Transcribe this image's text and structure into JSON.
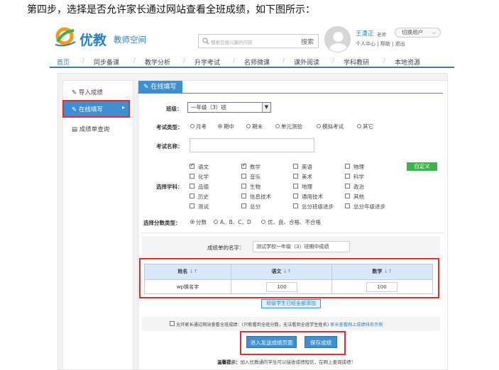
{
  "instruction": "第四步，选择是否允许家长通过网站查看全班成绩，如下图所示：",
  "header": {
    "brand": "优教",
    "brand_sub": "教师空间",
    "search_placeholder": "搜索您感兴趣的内容",
    "search_button": "搜索",
    "user_name": "王潇正",
    "user_role": "老师",
    "user_links": "个人中心 | 帮助 | 退出",
    "switch_user": "切换用户"
  },
  "nav": [
    "首页",
    "同步备课",
    "教学分析",
    "升学考试",
    "名师微课",
    "课外阅读",
    "学科教研",
    "本地资源"
  ],
  "sidebar": {
    "items": [
      "导入成绩",
      "在线填写",
      "成绩单查询"
    ]
  },
  "form": {
    "tab": "在线填写",
    "class_label": "班级：",
    "class_value": "一年级（3）班",
    "exam_type_label": "考试类型：",
    "exam_types": [
      "月考",
      "期中",
      "期末",
      "单元测验",
      "模拟考试",
      "其它"
    ],
    "exam_name_label": "考试名称：",
    "subject_label": "选择学科：",
    "custom_button": "自定义",
    "subjects": [
      [
        "语文",
        "数学",
        "英语",
        "物理"
      ],
      [
        "化学",
        "音乐",
        "美术",
        "科学"
      ],
      [
        "品德",
        "生物",
        "地理",
        "政治"
      ],
      [
        "历史",
        "信息技术",
        "通用技术",
        "其他"
      ],
      [
        "测试",
        "总分",
        "总分班级进步",
        "总分年级进步"
      ]
    ],
    "score_type_label": "选择分数类型：",
    "score_types": [
      "分数",
      "A、B、C、D",
      "优、良、合格、不合格"
    ],
    "report_name_label": "成绩单的名字：",
    "report_name_value": "测试学校一年级（3）班期中成绩"
  },
  "table": {
    "headers": [
      "姓名",
      "语文",
      "数学"
    ],
    "sort_icon": "↓↑",
    "rows": [
      {
        "name": "wp换名字",
        "chinese": "100",
        "math": "100"
      }
    ]
  },
  "add_students_button": "班级学生已经全部添加",
  "allow_text": "允许家长通过网站查看全班成绩：(只能看到全班分数，无法看到全班学生姓名)",
  "allow_link": "家长查看网上成绩排名示例",
  "buttons": {
    "send": "进入发送成绩页面",
    "save": "保存成绩"
  },
  "tip_label": "温馨提示：",
  "tip_text": "加入优教通的学生可以接收成绩短信，在网上查询成绩！"
}
